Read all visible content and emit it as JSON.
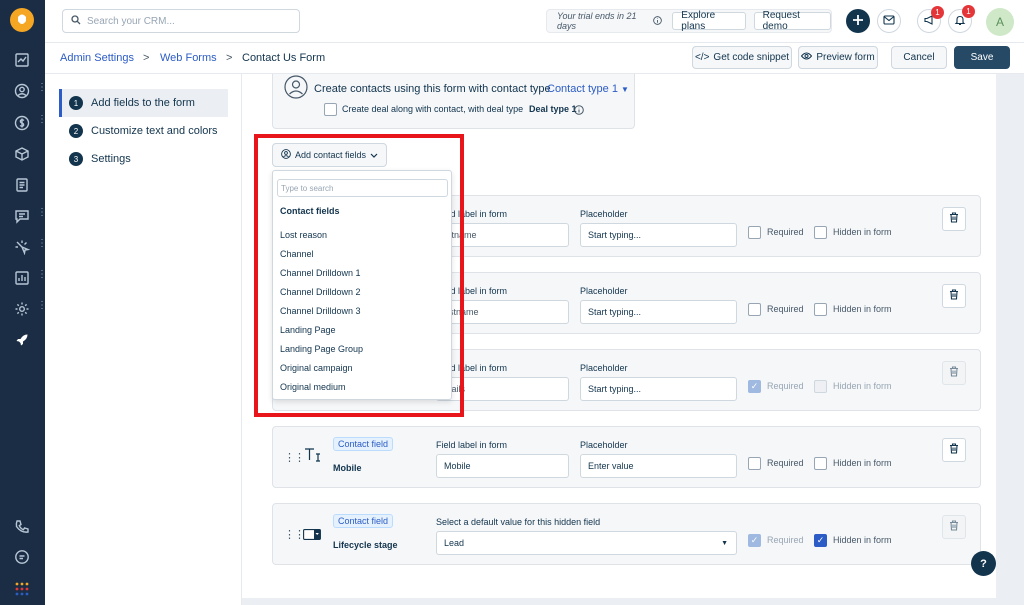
{
  "topbar": {
    "search_placeholder": "Search your CRM...",
    "trial_text": "Your trial ends in 21 days",
    "explore_plans": "Explore plans",
    "request_demo": "Request demo",
    "badge_updates": "1",
    "badge_notifications": "1",
    "avatar_initial": "A"
  },
  "breadcrumb": {
    "admin_settings": "Admin Settings",
    "web_forms": "Web Forms",
    "current": "Contact Us Form",
    "separator": ">"
  },
  "actions": {
    "get_code": "Get code snippet",
    "get_code_prefix": "</>",
    "preview": "Preview form",
    "cancel": "Cancel",
    "save": "Save"
  },
  "steps": [
    {
      "num": "1",
      "label": "Add fields to the form"
    },
    {
      "num": "2",
      "label": "Customize text and colors"
    },
    {
      "num": "3",
      "label": "Settings"
    }
  ],
  "contact_type": {
    "text": "Create contacts using this form with contact type",
    "type_value": "Contact type 1",
    "deal_text": "Create deal along with contact, with deal type",
    "deal_type": "Deal type 1"
  },
  "add_fields": {
    "button_label": "Add contact fields",
    "search_placeholder": "Type to search",
    "group_label": "Contact fields",
    "items": [
      "Lost reason",
      "Channel",
      "Channel Drilldown 1",
      "Channel Drilldown 2",
      "Channel Drilldown 3",
      "Landing Page",
      "Landing Page Group",
      "Original campaign",
      "Original medium"
    ]
  },
  "field_cards": {
    "headers": {
      "field_label": "Field label in form",
      "placeholder": "Placeholder",
      "default_value": "Select a default value for this hidden field"
    },
    "required_label": "Required",
    "hidden_label": "Hidden in form",
    "chip": "Contact field",
    "row1": {
      "label_value": "rstname",
      "placeholder_value": "Start typing..."
    },
    "row2": {
      "label_value": "astname",
      "placeholder_value": "Start typing..."
    },
    "row3": {
      "label_value": "mails",
      "placeholder_value": "Start typing..."
    },
    "mobile": {
      "name": "Mobile",
      "label_value": "Mobile",
      "placeholder_value": "Enter value"
    },
    "lifecycle": {
      "name": "Lifecycle stage",
      "default_value": "Lead"
    }
  },
  "help_label": "?",
  "colors": {
    "accent": "#2c5cc5",
    "sidebar": "#1a2d44",
    "save": "#264966",
    "highlight": "#e8151b"
  }
}
